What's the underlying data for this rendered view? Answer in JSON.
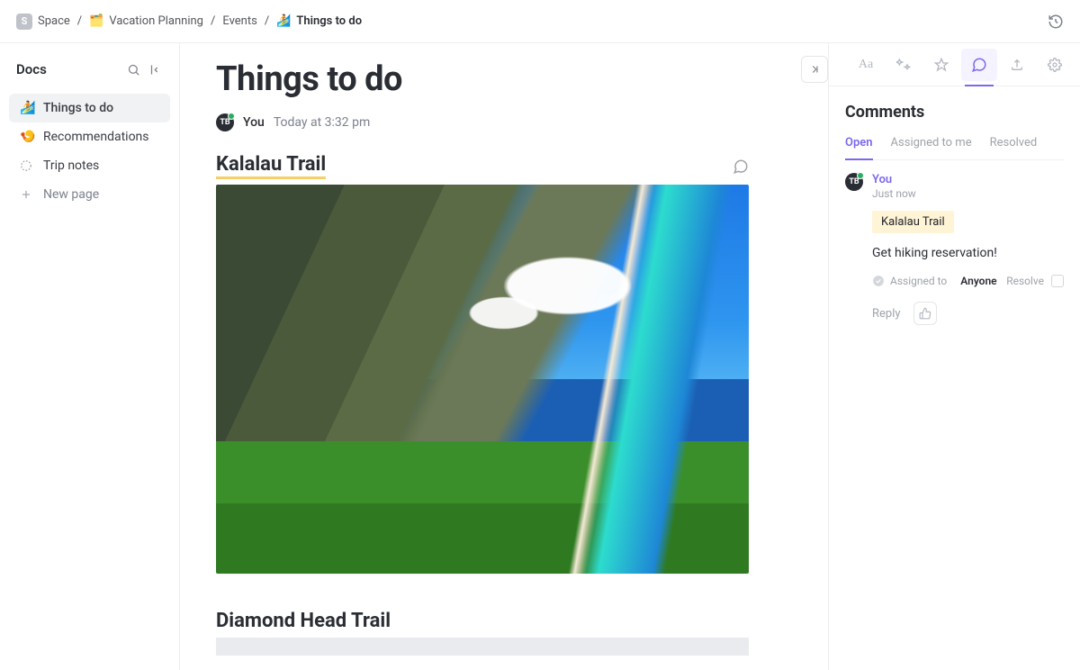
{
  "breadcrumb": {
    "space_badge": "S",
    "items": [
      "Space",
      "Vacation Planning",
      "Events",
      "Things to do"
    ],
    "folder_icon": "🗂️",
    "page_icon": "🏄"
  },
  "sidebar": {
    "title": "Docs",
    "items": [
      {
        "icon": "🏄",
        "label": "Things to do",
        "active": true
      },
      {
        "icon": "🍤",
        "label": "Recommendations",
        "active": false
      },
      {
        "icon": "loading",
        "label": "Trip notes",
        "active": false
      }
    ],
    "new_page_label": "New page"
  },
  "page": {
    "title": "Things to do",
    "avatar_initials": "TB",
    "author": "You",
    "timestamp": "Today at 3:32 pm",
    "sections": [
      {
        "title": "Kalalau Trail",
        "has_comment": true
      },
      {
        "title": "Diamond Head Trail",
        "has_comment": false
      }
    ]
  },
  "panel": {
    "title": "Comments",
    "tabs": [
      "Open",
      "Assigned to me",
      "Resolved"
    ],
    "active_tab": 0,
    "thread": {
      "avatar_initials": "TB",
      "author": "You",
      "time": "Just now",
      "ref": "Kalalau Trail",
      "text": "Get hiking reservation!",
      "assigned_to_label": "Assigned to",
      "assigned_to": "Anyone",
      "resolve_label": "Resolve",
      "reply_label": "Reply"
    }
  },
  "tooling": {
    "font_label": "Aa"
  }
}
